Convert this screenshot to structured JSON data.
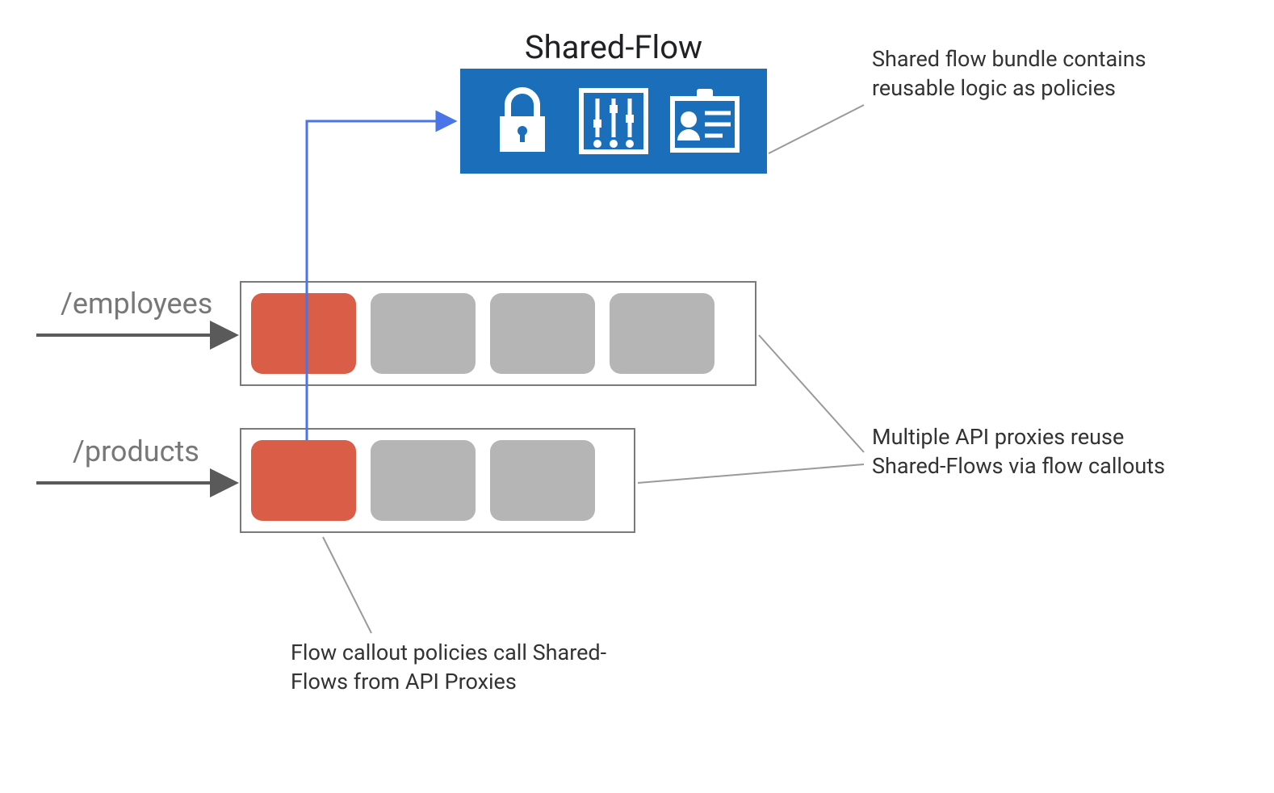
{
  "title": "Shared-Flow",
  "paths": {
    "employees": "/employees",
    "products": "/products"
  },
  "annotations": {
    "shared_bundle": "Shared flow bundle contains reusable logic as policies",
    "multi_proxies": "Multiple API proxies reuse Shared-Flows via flow callouts",
    "flow_callout": "Flow callout policies call Shared-Flows from API Proxies"
  },
  "icons": {
    "lock": "lock-icon",
    "sliders": "sliders-icon",
    "badge": "id-badge-icon"
  },
  "colors": {
    "shared_flow_bg": "#1b6fba",
    "callout_block": "#d95d47",
    "generic_block": "#b5b5b5",
    "arrow_blue": "#4a74e8",
    "arrow_gray": "#5a5a5a",
    "anno_line": "#9a9a9a"
  }
}
